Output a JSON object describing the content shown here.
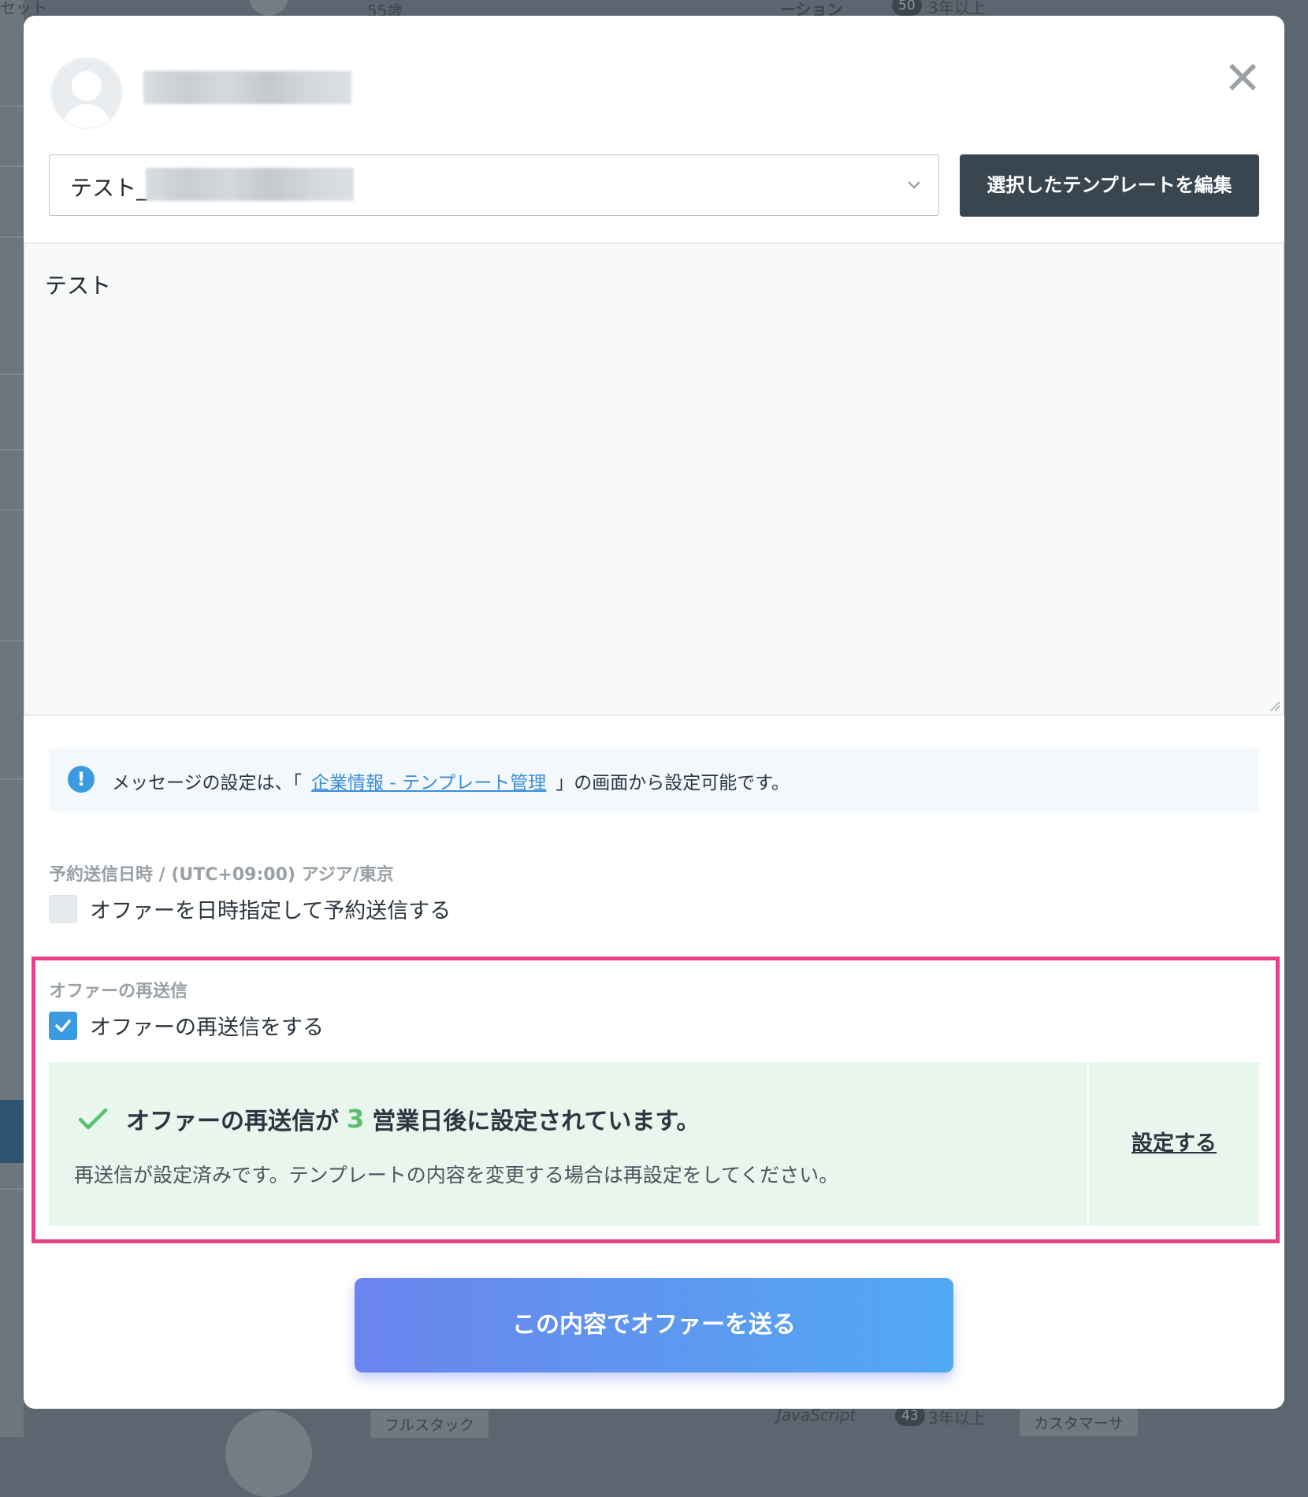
{
  "background": {
    "top_text_left": "セット",
    "top_text_mid": "55歳",
    "top_text_right": "ーション",
    "top_badge": "50",
    "top_years": "3年以上",
    "bottom_chip": "フルスタック",
    "bottom_skill": "JavaScript",
    "bottom_badge": "43",
    "bottom_years": "3年以上",
    "bottom_role": "カスタマーサ"
  },
  "modal": {
    "close_icon": "close-icon",
    "template_select": {
      "value_prefix": "テスト_",
      "chevron_icon": "chevron-down-icon"
    },
    "edit_template_label": "選択したテンプレートを編集",
    "message_body": "テスト",
    "info": {
      "icon": "info-icon",
      "text_before": "メッセージの設定は、「",
      "link_text": "企業情報 - テンプレート管理",
      "text_after": "」の画面から設定可能です。"
    },
    "schedule": {
      "label": "予約送信日時 / (UTC+09:00) アジア/東京",
      "checkbox_label": "オファーを日時指定して予約送信する",
      "checked": false
    },
    "resend": {
      "label": "オファーの再送信",
      "checkbox_label": "オファーの再送信をする",
      "checked": true,
      "status_prefix": "オファーの再送信が",
      "status_days": "3",
      "status_suffix": "営業日後に設定されています。",
      "status_note": "再送信が設定済みです。テンプレートの内容を変更する場合は再設定をしてください。",
      "setting_link": "設定する"
    },
    "send_button_label": "この内容でオファーを送る"
  },
  "colors": {
    "primary_dark": "#394650",
    "accent_blue": "#3b9be0",
    "success_green": "#58c06f",
    "highlight_pink": "#e6408a",
    "send_gradient_start": "#6b84ee",
    "send_gradient_end": "#52a9f2"
  }
}
